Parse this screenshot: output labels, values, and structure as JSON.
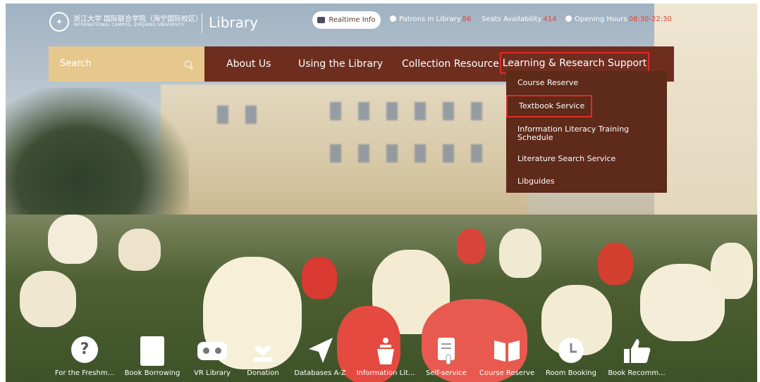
{
  "header": {
    "logo": {
      "cn": "浙江大学 国际联合学院（海宁国际校区）",
      "en": "INTERNATIONAL CAMPUS, ZHEJIANG UNIVERSITY"
    },
    "title": "Library",
    "realtime_button": "Realtime Info",
    "patrons_label": "Patrons in Library",
    "patrons_count": "86",
    "seats_label": "Seats Availability",
    "seats_count": "414",
    "hours_label": "Opening Hours",
    "hours_value": "08:30-22:30"
  },
  "search": {
    "placeholder": "Search"
  },
  "nav": {
    "items": [
      "About Us",
      "Using the Library",
      "Collection Resource",
      "Learning & Research Support"
    ],
    "active_index": 3
  },
  "dropdown": {
    "items": [
      "Course Reserve",
      "Textbook Service",
      "Information Literacy Training Schedule",
      "Literature Search Service",
      "Libguides"
    ],
    "highlighted_index": 1
  },
  "quick_links": [
    {
      "label": "For the Freshm...",
      "icon": "question-icon"
    },
    {
      "label": "Book Borrowing",
      "icon": "book-icon"
    },
    {
      "label": "VR Library",
      "icon": "vr-headset-icon"
    },
    {
      "label": "Donation",
      "icon": "heart-hand-icon"
    },
    {
      "label": "Databases A-Z",
      "icon": "paper-plane-icon"
    },
    {
      "label": "Information Lit...",
      "icon": "podium-icon"
    },
    {
      "label": "Self-service",
      "icon": "document-touch-icon"
    },
    {
      "label": "Course Reserve",
      "icon": "open-book-icon"
    },
    {
      "label": "Room Booking",
      "icon": "clock-icon"
    },
    {
      "label": "Book Recomm...",
      "icon": "thumbs-up-icon"
    }
  ],
  "colors": {
    "nav_bg": "#6e2e1f",
    "dropdown_bg": "#5e2a1a",
    "search_bg": "#e6c88f",
    "highlight_border": "#e12a27",
    "stat_number": "#e04535"
  }
}
